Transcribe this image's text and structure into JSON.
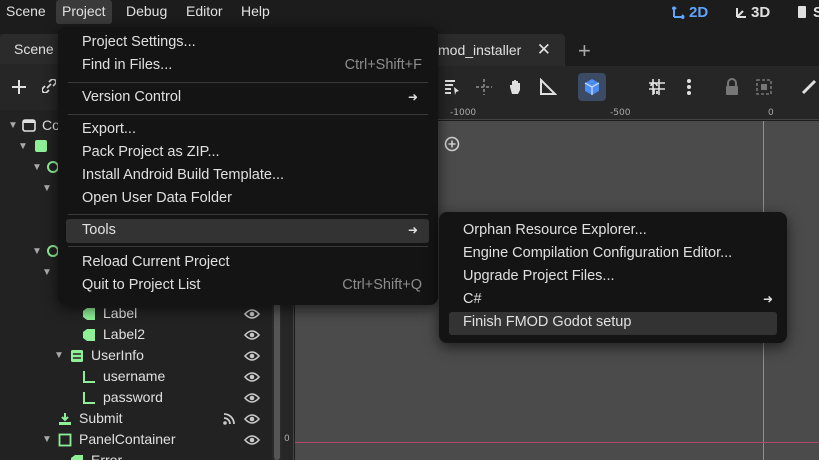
{
  "menubar": {
    "items": [
      "Scene",
      "Project",
      "Debug",
      "Editor",
      "Help"
    ],
    "active": "Project",
    "view_2d": "2D",
    "view_3d": "3D",
    "view_script_partial": "S"
  },
  "dock": {
    "tab_label": "Scene",
    "tree": [
      {
        "label": "Co",
        "icon": "root-node-icon",
        "color": "#e0e0e0"
      },
      {
        "label": "",
        "icon": "control-icon",
        "color": "#8eef97"
      },
      {
        "label": "Label",
        "icon": "label-icon",
        "color": "#8eef97"
      },
      {
        "label": "Label2",
        "icon": "label-icon",
        "color": "#8eef97"
      },
      {
        "label": "UserInfo",
        "icon": "vbox-icon",
        "color": "#8eef97"
      },
      {
        "label": "username",
        "icon": "line-edit-icon",
        "color": "#8eef97"
      },
      {
        "label": "password",
        "icon": "line-edit-icon",
        "color": "#8eef97"
      },
      {
        "label": "Submit",
        "icon": "button-icon",
        "color": "#8eef97"
      },
      {
        "label": "PanelContainer",
        "icon": "panel-container-icon",
        "color": "#8eef97"
      },
      {
        "label": "Error",
        "icon": "label-icon",
        "color": "#8eef97"
      }
    ]
  },
  "editor": {
    "scene_tab": "mod_installer",
    "ruler": {
      "minus_1000": "-1000",
      "minus_500": "-500",
      "zero": "0",
      "left_zero": "0"
    }
  },
  "project_menu": {
    "items": [
      {
        "label": "Project Settings...",
        "shortcut": ""
      },
      {
        "label": "Find in Files...",
        "shortcut": "Ctrl+Shift+F"
      },
      {
        "label": "Version Control",
        "shortcut": "",
        "submenu": true
      },
      {
        "label": "Export...",
        "shortcut": ""
      },
      {
        "label": "Pack Project as ZIP...",
        "shortcut": ""
      },
      {
        "label": "Install Android Build Template...",
        "shortcut": ""
      },
      {
        "label": "Open User Data Folder",
        "shortcut": ""
      },
      {
        "label": "Tools",
        "shortcut": "",
        "submenu": true
      },
      {
        "label": "Reload Current Project",
        "shortcut": ""
      },
      {
        "label": "Quit to Project List",
        "shortcut": "Ctrl+Shift+Q"
      }
    ]
  },
  "tools_menu": {
    "items": [
      {
        "label": "Orphan Resource Explorer..."
      },
      {
        "label": "Engine Compilation Configuration Editor..."
      },
      {
        "label": "Upgrade Project Files..."
      },
      {
        "label": "C#",
        "submenu": true
      },
      {
        "label": "Finish FMOD Godot setup"
      }
    ]
  },
  "colors": {
    "accent_2d": "#5fa5ff",
    "node_green": "#8eef97",
    "x_axis": "#b04a6a",
    "y_axis": "#7aa54a"
  }
}
